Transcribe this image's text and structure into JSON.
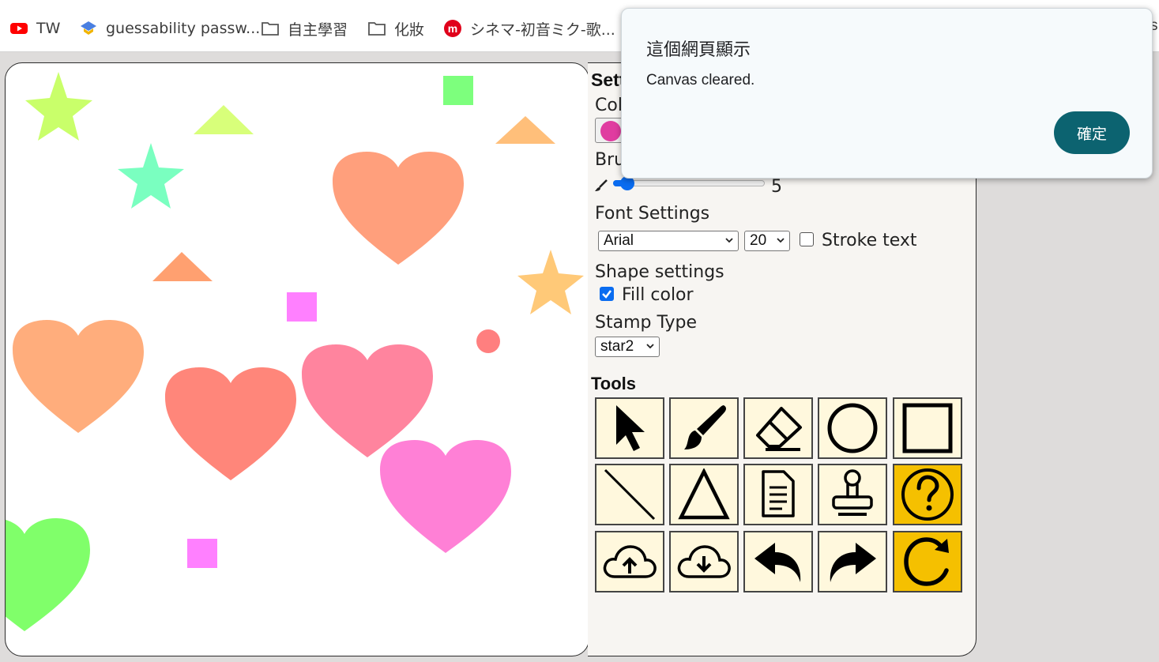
{
  "bookmarks": [
    {
      "label": "TW",
      "icon": "youtube-icon"
    },
    {
      "label": "guessability passw...",
      "icon": "site-icon"
    },
    {
      "label": "自主學習",
      "icon": "folder-icon"
    },
    {
      "label": "化妝",
      "icon": "folder-icon"
    },
    {
      "label": "シネマ-初音ミク-歌...",
      "icon": "m-logo-icon"
    }
  ],
  "bookmarks_overflow_fragment": "s",
  "settings": {
    "title_fragment": "Sett",
    "color_label_fragment": "Col",
    "color_value": "#e03ca0",
    "brush_label_fragment": "Bru",
    "brush_size": "5",
    "brush_level_fraction": 0.05,
    "font_settings_label": "Font Settings",
    "font_family": "Arial",
    "font_size": "20",
    "stroke_text_label": "Stroke text",
    "stroke_text_checked": false,
    "shape_settings_label": "Shape settings",
    "fill_color_label": "Fill color",
    "fill_color_checked": true,
    "stamp_type_label": "Stamp Type",
    "stamp_type": "star2"
  },
  "tools_label": "Tools",
  "tools": [
    {
      "name": "select-tool",
      "icon": "cursor-icon",
      "highlighted": false
    },
    {
      "name": "brush-tool",
      "icon": "paintbrush-icon",
      "highlighted": false
    },
    {
      "name": "eraser-tool",
      "icon": "eraser-icon",
      "highlighted": false
    },
    {
      "name": "circle-tool",
      "icon": "circle-icon",
      "highlighted": false
    },
    {
      "name": "rectangle-tool",
      "icon": "square-icon",
      "highlighted": false
    },
    {
      "name": "line-tool",
      "icon": "line-icon",
      "highlighted": false
    },
    {
      "name": "triangle-tool",
      "icon": "triangle-icon",
      "highlighted": false
    },
    {
      "name": "text-tool",
      "icon": "document-icon",
      "highlighted": false
    },
    {
      "name": "stamp-tool",
      "icon": "stamp-icon",
      "highlighted": false
    },
    {
      "name": "help-tool",
      "icon": "question-icon",
      "highlighted": true
    },
    {
      "name": "upload-tool",
      "icon": "cloud-upload-icon",
      "highlighted": false
    },
    {
      "name": "download-tool",
      "icon": "cloud-download-icon",
      "highlighted": false
    },
    {
      "name": "undo-tool",
      "icon": "undo-icon",
      "highlighted": false
    },
    {
      "name": "redo-tool",
      "icon": "redo-icon",
      "highlighted": false
    },
    {
      "name": "clear-tool",
      "icon": "refresh-icon",
      "highlighted": true
    }
  ],
  "dialog": {
    "title": "這個網頁顯示",
    "message": "Canvas cleared.",
    "ok_label": "確定"
  },
  "colors": {
    "dialog_button": "#0c6370",
    "tool_bg": "#fff8dd",
    "tool_highlight": "#f5c000",
    "accent": "#0a6cf0"
  },
  "canvas_shapes": [
    {
      "type": "star",
      "color": "#c9ff6a"
    },
    {
      "type": "triangle",
      "color": "#d8ff7a"
    },
    {
      "type": "square",
      "color": "#7dff7d"
    },
    {
      "type": "triangle",
      "color": "#ffbf7a"
    },
    {
      "type": "star",
      "color": "#7affc0"
    },
    {
      "type": "heart",
      "color": "#ff9f7c"
    },
    {
      "type": "triangle",
      "color": "#ffa070"
    },
    {
      "type": "star",
      "color": "#ffc978"
    },
    {
      "type": "square",
      "color": "#ff80ff"
    },
    {
      "type": "circle",
      "color": "#ff7f7f"
    },
    {
      "type": "heart",
      "color": "#ffad7c"
    },
    {
      "type": "heart",
      "color": "#ff867a"
    },
    {
      "type": "heart",
      "color": "#ff849e"
    },
    {
      "type": "heart",
      "color": "#ff80d6"
    },
    {
      "type": "heart",
      "color": "#80ff6a"
    },
    {
      "type": "square",
      "color": "#ff80ff"
    }
  ]
}
